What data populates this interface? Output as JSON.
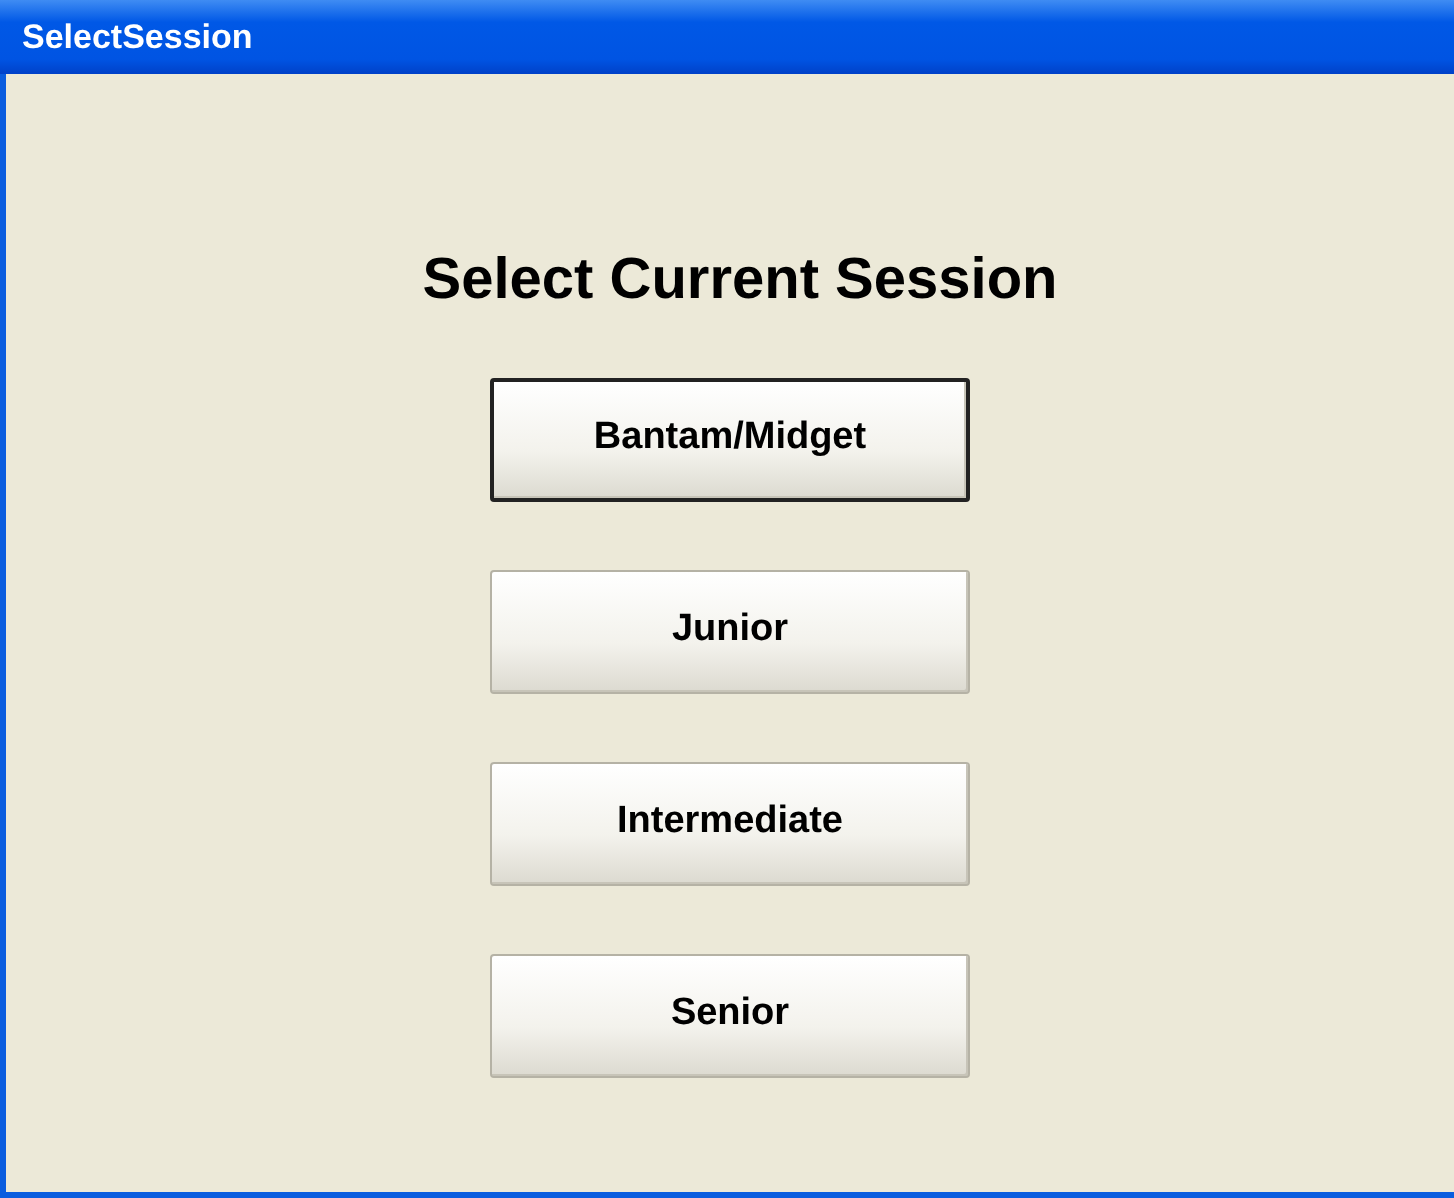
{
  "window": {
    "title": "SelectSession"
  },
  "heading": "Select Current Session",
  "buttons": [
    {
      "label": "Bantam/Midget",
      "default": true
    },
    {
      "label": "Junior",
      "default": false
    },
    {
      "label": "Intermediate",
      "default": false
    },
    {
      "label": "Senior",
      "default": false
    }
  ]
}
